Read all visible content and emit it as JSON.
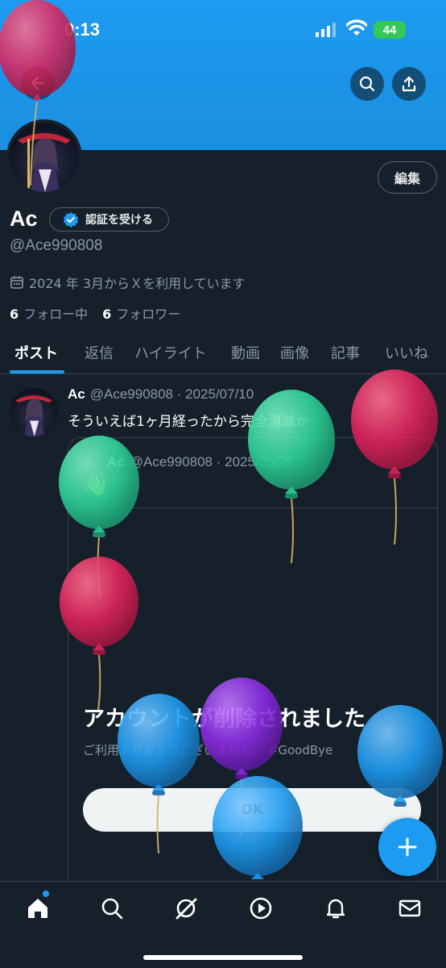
{
  "status_bar": {
    "time": "0:13",
    "battery": "44"
  },
  "profile": {
    "name": "Ac",
    "verify_label": "認証を受ける",
    "handle": "@Ace990808",
    "joined": "2024 年 3月からＸを利用しています",
    "following_count": "6",
    "following_label": "フォロー中",
    "followers_count": "6",
    "followers_label": "フォロワー",
    "edit_label": "編集"
  },
  "tabs": [
    {
      "label": "ポスト",
      "active": true
    },
    {
      "label": "返信"
    },
    {
      "label": "ハイライト"
    },
    {
      "label": "動画"
    },
    {
      "label": "画像"
    },
    {
      "label": "記事"
    },
    {
      "label": "いいね"
    }
  ],
  "post": {
    "author": "Ac",
    "meta": "@Ace990808 · 2025/07/10",
    "text": "そういえば1ヶ月経ったから完全消滅か",
    "quote": {
      "author": "Ac",
      "meta": "@Ace990808 · 2025/05/25",
      "wave": "👋",
      "deleted_title": "アカウントが削除されました",
      "deleted_sub": "ご利用ありがとうございました。 #GoodBye",
      "ok_label": "OK"
    }
  },
  "icons": [
    "back-arrow-icon",
    "search-icon",
    "share-icon",
    "calendar-icon",
    "verified-badge-icon",
    "plus-icon",
    "home-icon",
    "explore-icon",
    "grok-icon",
    "video-icon",
    "bell-icon",
    "mail-icon"
  ],
  "colors": {
    "accent": "#1d9bf0",
    "background": "#15202b",
    "balloon_red": "#e0245e",
    "balloon_green": "#2ed39a",
    "balloon_blue": "#1d9bf0",
    "balloon_purple": "#8a2be2"
  }
}
